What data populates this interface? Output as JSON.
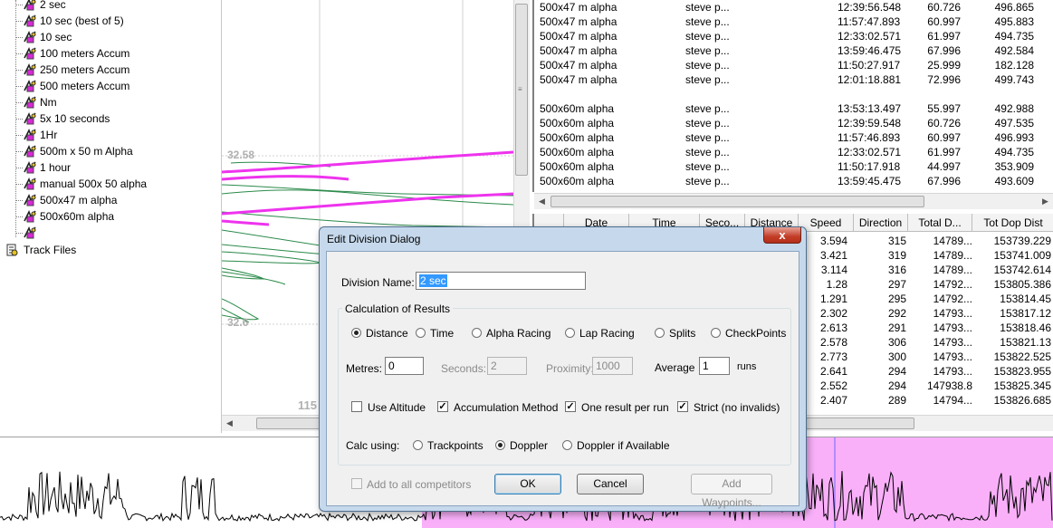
{
  "tree": {
    "items": [
      "2 sec",
      "10 sec (best of 5)",
      "10 sec",
      "100 meters Accum",
      "250 meters Accum",
      "500 meters Accum",
      "Nm",
      "5x 10 seconds",
      "1Hr",
      "500m x 50 m Alpha",
      "1 hour",
      "manual 500x 50 alpha",
      "500x47 m alpha",
      "500x60m alpha",
      ""
    ],
    "track_files_label": "Track Files"
  },
  "plot": {
    "label_top": "32.58",
    "label_mid": "32.6",
    "label_bottom": "115"
  },
  "results": {
    "rows": [
      [
        "500x47 m alpha",
        "steve p...",
        "12:39:56.548",
        "60.726",
        "496.865"
      ],
      [
        "500x47 m alpha",
        "steve p...",
        "11:57:47.893",
        "60.997",
        "495.883"
      ],
      [
        "500x47 m alpha",
        "steve p...",
        "12:33:02.571",
        "61.997",
        "494.735"
      ],
      [
        "500x47 m alpha",
        "steve p...",
        "13:59:46.475",
        "67.996",
        "492.584"
      ],
      [
        "500x47 m alpha",
        "steve p...",
        "11:50:27.917",
        "25.999",
        "182.128"
      ],
      [
        "500x47 m alpha",
        "steve p...",
        "12:01:18.881",
        "72.996",
        "499.743"
      ],
      [
        "",
        "",
        "",
        "",
        ""
      ],
      [
        "500x60m alpha",
        "steve p...",
        "13:53:13.497",
        "55.997",
        "492.988"
      ],
      [
        "500x60m alpha",
        "steve p...",
        "12:39:59.548",
        "60.726",
        "497.535"
      ],
      [
        "500x60m alpha",
        "steve p...",
        "11:57:46.893",
        "60.997",
        "496.993"
      ],
      [
        "500x60m alpha",
        "steve p...",
        "12:33:02.571",
        "61.997",
        "494.735"
      ],
      [
        "500x60m alpha",
        "steve p...",
        "11:50:17.918",
        "44.997",
        "353.909"
      ],
      [
        "500x60m alpha",
        "steve p...",
        "13:59:45.475",
        "67.996",
        "493.609"
      ]
    ]
  },
  "grid": {
    "headers": [
      "",
      "Date",
      "Time",
      "Seco...",
      "Distance",
      "Speed",
      "Direction",
      "Total D...",
      "Tot Dop Dist"
    ],
    "rows": [
      [
        "3.594",
        "315",
        "14789...",
        "153739.229"
      ],
      [
        "3.421",
        "319",
        "14789...",
        "153741.009"
      ],
      [
        "3.114",
        "316",
        "14789...",
        "153742.614"
      ],
      [
        "1.28",
        "297",
        "14792...",
        "153805.386"
      ],
      [
        "1.291",
        "295",
        "14792...",
        "153814.45"
      ],
      [
        "2.302",
        "292",
        "14793...",
        "153817.12"
      ],
      [
        "2.613",
        "291",
        "14793...",
        "153818.46"
      ],
      [
        "2.578",
        "306",
        "14793...",
        "153821.13"
      ],
      [
        "2.773",
        "300",
        "14793...",
        "153822.525"
      ],
      [
        "2.641",
        "294",
        "14793...",
        "153823.955"
      ],
      [
        "2.552",
        "294",
        "147938.8",
        "153825.345"
      ],
      [
        "2.407",
        "289",
        "14794...",
        "153826.685"
      ]
    ]
  },
  "dialog": {
    "title": "Edit Division Dialog",
    "close_label": "x",
    "division_name_label": "Division Name:",
    "division_name_value": "2 sec",
    "calc_group_label": "Calculation of Results",
    "calc_options": [
      "Distance",
      "Time",
      "Alpha Racing",
      "Lap Racing",
      "Splits",
      "CheckPoints"
    ],
    "calc_selected": "Distance",
    "metres_label": "Metres:",
    "metres_value": "0",
    "seconds_label": "Seconds:",
    "seconds_value": "2",
    "proximity_label": "Proximity:",
    "proximity_value": "1000",
    "average_label": "Average",
    "average_value": "1",
    "runs_label": "runs",
    "use_altitude_label": "Use Altitude",
    "use_altitude_checked": false,
    "accumulation_label": "Accumulation Method",
    "accumulation_checked": true,
    "one_result_label": "One result per run",
    "one_result_checked": true,
    "strict_label": "Strict (no invalids)",
    "strict_checked": true,
    "calc_using_label": "Calc using:",
    "calc_using_options": [
      "Trackpoints",
      "Doppler",
      "Doppler if Available"
    ],
    "calc_using_selected": "Doppler",
    "add_all_label": "Add to all competitors",
    "ok_label": "OK",
    "cancel_label": "Cancel",
    "add_waypoints_label": "Add Waypoints..."
  },
  "colors": {
    "track_highlight": "#ee33ee",
    "track_normal": "#2a8a4a",
    "bottom_highlight": "#f9b0f9",
    "dialog_frame": "#c6d9ec"
  }
}
